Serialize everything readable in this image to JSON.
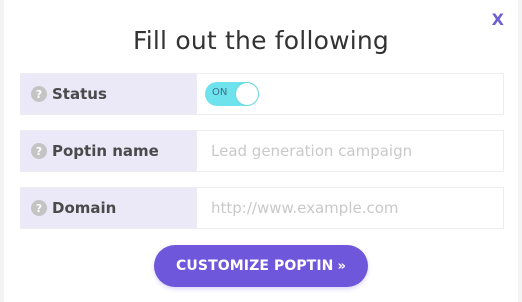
{
  "modal": {
    "title": "Fill out the following",
    "close_label": "X"
  },
  "fields": {
    "status": {
      "label": "Status",
      "help_icon": "?",
      "toggle_text": "ON",
      "toggle_state": "on"
    },
    "poptin_name": {
      "label": "Poptin name",
      "help_icon": "?",
      "value": "",
      "placeholder": "Lead generation campaign"
    },
    "domain": {
      "label": "Domain",
      "help_icon": "?",
      "value": "",
      "placeholder": "http://www.example.com"
    }
  },
  "cta": {
    "label": "CUSTOMIZE POPTIN",
    "icon": "double-chevron-right-icon",
    "glyph": "»"
  },
  "colors": {
    "accent": "#6e57db",
    "close": "#6f5fd4",
    "label_bg": "#ebe8f8",
    "toggle_on": "#6ee3ee"
  }
}
